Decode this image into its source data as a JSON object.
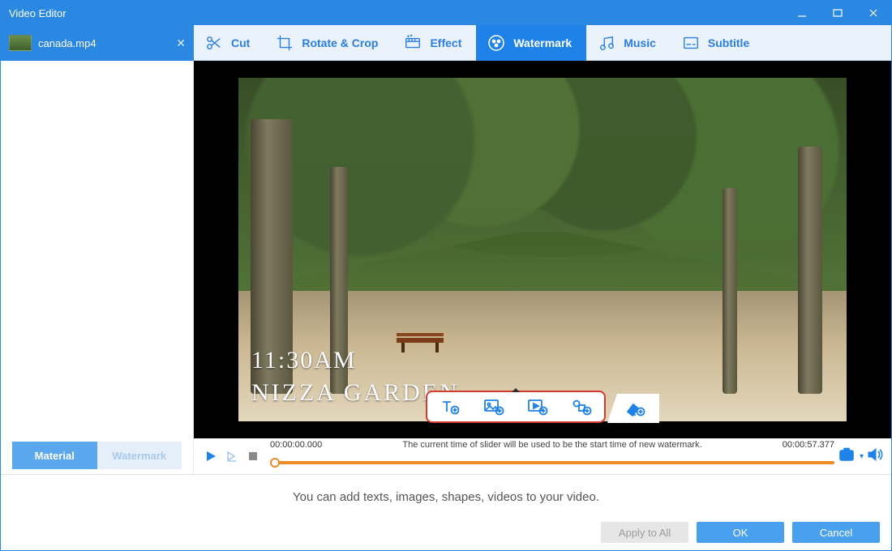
{
  "window": {
    "title": "Video Editor"
  },
  "file_tab": {
    "name": "canada.mp4"
  },
  "toolbar": {
    "cut": "Cut",
    "rotate_crop": "Rotate & Crop",
    "effect": "Effect",
    "watermark": "Watermark",
    "music": "Music",
    "subtitle": "Subtitle",
    "active": "watermark"
  },
  "sidebar_tabs": {
    "material": "Material",
    "watermark": "Watermark",
    "active": "material"
  },
  "preview_overlay": {
    "time_text": "11:30AM",
    "place_text": "NIZZA GARDEN"
  },
  "watermark_tools": {
    "add_text": "add-text",
    "add_image": "add-image",
    "add_video": "add-video",
    "add_shape": "add-shape",
    "remove": "erase"
  },
  "timeline": {
    "current": "00:00:00.000",
    "duration": "00:00:57.377",
    "hint": "The current time of slider will be used to be the start time of new watermark."
  },
  "bottom": {
    "message": "You can add texts, images, shapes, videos to your video.",
    "apply_all": "Apply to All",
    "ok": "OK",
    "cancel": "Cancel"
  }
}
